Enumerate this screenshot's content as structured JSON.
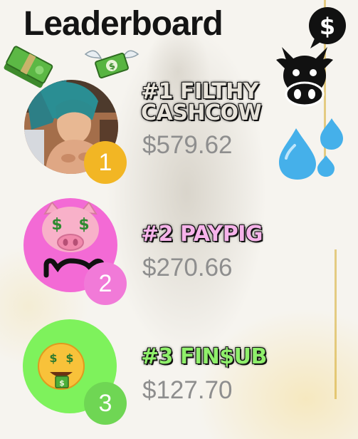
{
  "title": "Leaderboard",
  "entries": [
    {
      "rank": "1",
      "name_line1": "#1 FILTHY",
      "name_line2": "CASHCOW",
      "amount": "$579.62"
    },
    {
      "rank": "2",
      "name": "#2 PAYPIG",
      "amount": "$270.66"
    },
    {
      "rank": "3",
      "name": "#3 FIN$UB",
      "amount": "$127.70"
    }
  ],
  "icons": {
    "money_stack": "money-stack-icon",
    "money_wings": "money-with-wings-icon",
    "dollar_bubble": "dollar-speech-bubble-icon",
    "cow": "cow-face-icon",
    "sweat": "sweat-droplets-icon",
    "pig": "pig-face-icon",
    "money_mouth": "money-mouth-face-icon"
  },
  "colors": {
    "rank1_badge": "#f2b624",
    "rank2_circle": "#f36ad5",
    "rank2_badge": "#f17ad8",
    "rank3_circle": "#7ef25c",
    "rank3_badge": "#6fd654",
    "amount_text": "#8e8e8e",
    "name1": "#e7e3da",
    "name2": "#f6b3ea",
    "name3": "#8fef6b"
  }
}
